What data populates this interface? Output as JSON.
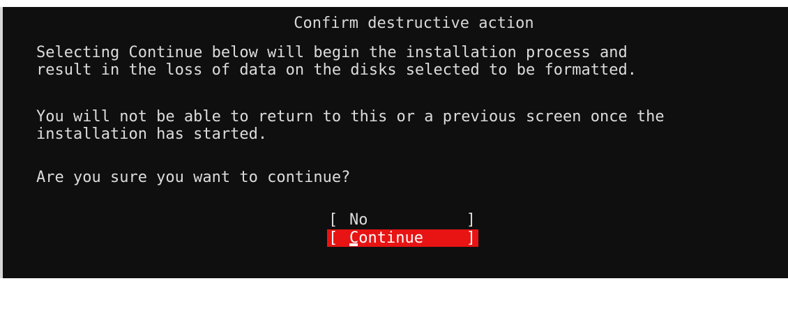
{
  "dialog": {
    "title": "Confirm destructive action",
    "paragraph1": "Selecting Continue below will begin the installation process and\nresult in the loss of data on the disks selected to be formatted.",
    "paragraph2": "You will not be able to return to this or a previous screen once the\ninstallation has started.",
    "question": "Are you sure you want to continue?",
    "buttons": {
      "no_label": "No",
      "continue_label": "Continue",
      "left_bracket": "[",
      "right_bracket": "]"
    }
  },
  "colors": {
    "background": "#0f0f0f",
    "text": "#dcdcdc",
    "selected_button": "#e81414"
  }
}
